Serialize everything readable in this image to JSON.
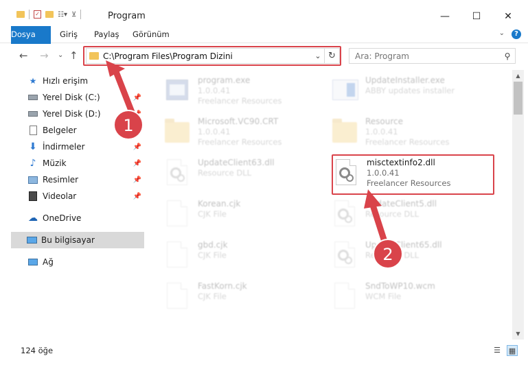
{
  "window": {
    "title": "Program",
    "minimize": "—",
    "maximize": "☐",
    "close": "✕"
  },
  "ribbon": {
    "tabs": [
      {
        "label": "Dosya"
      },
      {
        "label": "Giriş"
      },
      {
        "label": "Paylaş"
      },
      {
        "label": "Görünüm"
      }
    ]
  },
  "address_bar": {
    "path": "C:\\Program Files\\Program Dizini"
  },
  "search": {
    "placeholder": "Ara: Program"
  },
  "sidebar": {
    "quick_access": "Hızlı erişim",
    "items": [
      {
        "label": "Yerel Disk (C:)",
        "icon": "drive-icon",
        "pinned": true
      },
      {
        "label": "Yerel Disk (D:)",
        "icon": "drive-icon",
        "pinned": true
      },
      {
        "label": "Belgeler",
        "icon": "documents-icon",
        "pinned": true
      },
      {
        "label": "İndirmeler",
        "icon": "download-icon",
        "pinned": true
      },
      {
        "label": "Müzik",
        "icon": "music-icon",
        "pinned": true
      },
      {
        "label": "Resimler",
        "icon": "pictures-icon",
        "pinned": true
      },
      {
        "label": "Videolar",
        "icon": "videos-icon",
        "pinned": true
      }
    ],
    "onedrive": "OneDrive",
    "this_pc": "Bu bilgisayar",
    "network": "Ağ"
  },
  "files": [
    {
      "name": "program.exe",
      "line2": "1.0.0.41",
      "line3": "Freelancer Resources",
      "icon": "exe-icon",
      "faded": true
    },
    {
      "name": "UpdateInstaller.exe",
      "line2": "ABBY updates installer",
      "line3": "",
      "icon": "installer-icon",
      "faded": true
    },
    {
      "name": "Microsoft.VC90.CRT",
      "line2": "1.0.0.41",
      "line3": "Freelancer Resources",
      "icon": "folder-icon",
      "faded": true
    },
    {
      "name": "Resource",
      "line2": "1.0.0.41",
      "line3": "Freelancer Resources",
      "icon": "folder-icon",
      "faded": true
    },
    {
      "name": "UpdateClient63.dll",
      "line2": "Resource DLL",
      "line3": "",
      "icon": "dll-icon",
      "faded": true
    },
    {
      "name": "misctextinfo2.dll",
      "line2": "1.0.0.41",
      "line3": "Freelancer Resources",
      "icon": "dll-icon",
      "faded": false
    },
    {
      "name": "Korean.cjk",
      "line2": "CJK File",
      "line3": "",
      "icon": "file-icon",
      "faded": true
    },
    {
      "name": "UpdateClient5.dll",
      "line2": "Resource DLL",
      "line3": "",
      "icon": "dll-icon",
      "faded": true
    },
    {
      "name": "gbd.cjk",
      "line2": "CJK File",
      "line3": "",
      "icon": "file-icon",
      "faded": true
    },
    {
      "name": "UpdateClient65.dll",
      "line2": "Resource DLL",
      "line3": "",
      "icon": "dll-icon",
      "faded": true
    },
    {
      "name": "FastKorn.cjk",
      "line2": "CJK File",
      "line3": "",
      "icon": "file-icon",
      "faded": true
    },
    {
      "name": "SndToWP10.wcm",
      "line2": "WCM File",
      "line3": "",
      "icon": "file-icon",
      "faded": true
    }
  ],
  "status": {
    "count": "124 öğe"
  },
  "annotations": [
    {
      "number": "1"
    },
    {
      "number": "2"
    }
  ],
  "colors": {
    "accent": "#1979ca",
    "highlight": "#d9434a",
    "selected": "#d9d9d9"
  }
}
